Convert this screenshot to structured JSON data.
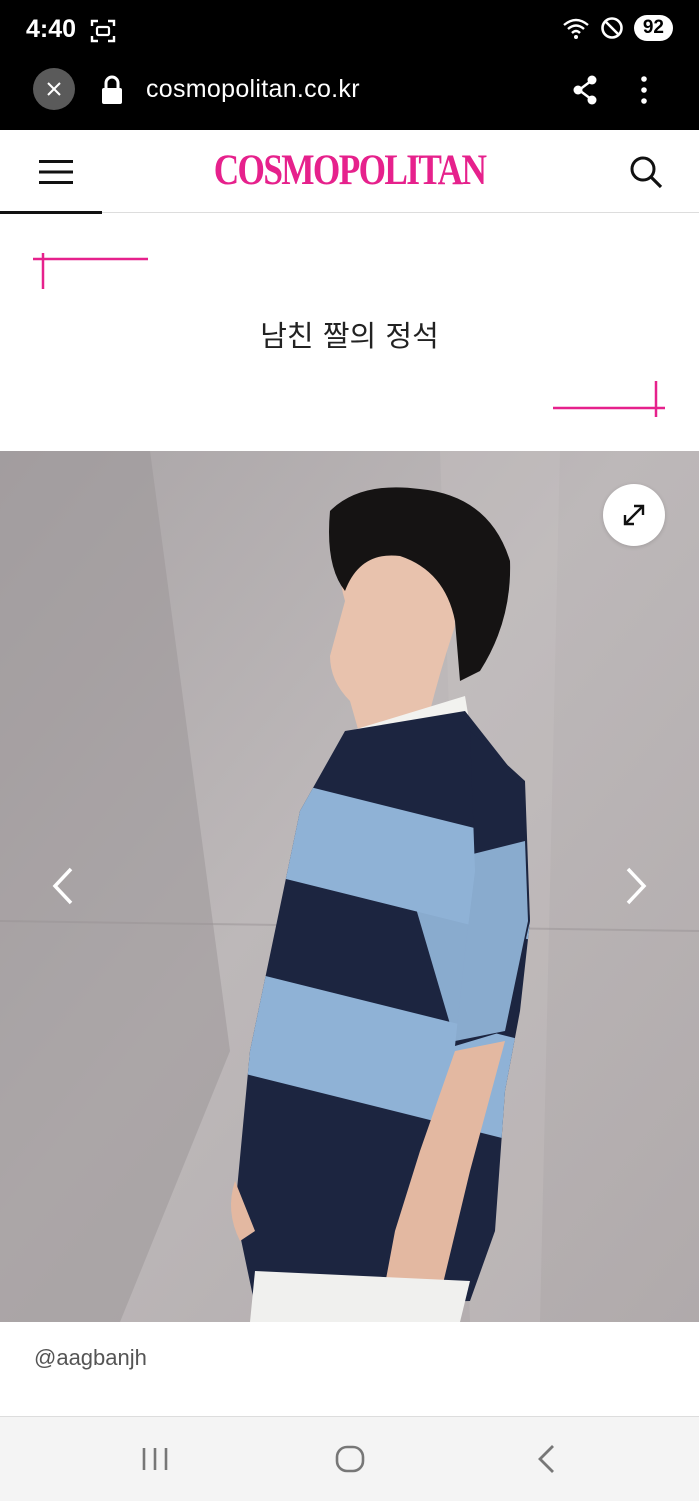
{
  "status_bar": {
    "time": "4:40",
    "battery": "92"
  },
  "browser": {
    "url": "cosmopolitan.co.kr"
  },
  "header": {
    "logo": "COSMOPOLITAN"
  },
  "article": {
    "title": "남친 짤의 정석"
  },
  "gallery": {
    "caption": "@aagbanjh"
  },
  "colors": {
    "brand": "#e6218c",
    "status_bar": "#000000"
  }
}
